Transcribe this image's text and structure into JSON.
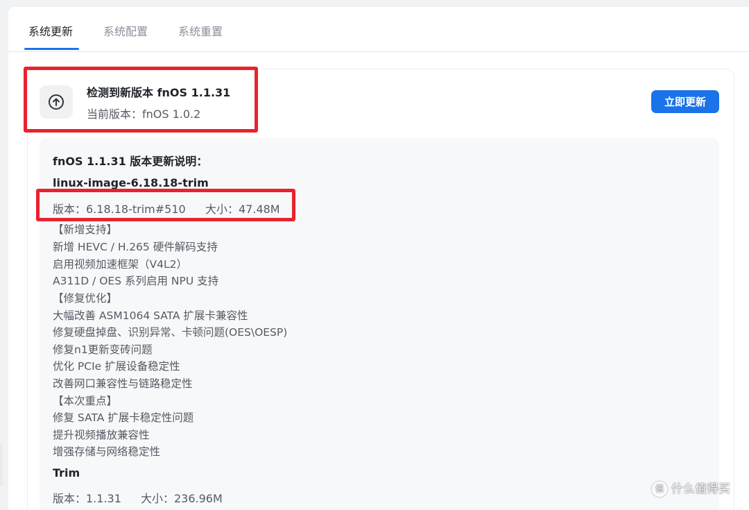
{
  "tabs": [
    {
      "label": "系统更新",
      "active": true
    },
    {
      "label": "系统配置",
      "active": false
    },
    {
      "label": "系统重置",
      "active": false
    }
  ],
  "update": {
    "icon": "arrow-up-circle-icon",
    "title": "检测到新版本 fnOS 1.1.31",
    "current_version": "当前版本：fnOS 1.0.2",
    "button_label": "立即更新"
  },
  "notes": {
    "heading": "fnOS 1.1.31 版本更新说明：",
    "packages": [
      {
        "name": "linux-image-6.18.18-trim",
        "version": "版本：6.18.18-trim#510",
        "size": "大小：47.48M",
        "lines": [
          "【新增支持】",
          "新增 HEVC / H.265 硬件解码支持",
          "启用视频加速框架（V4L2）",
          "A311D / OES 系列启用 NPU 支持",
          "【修复优化】",
          "大幅改善 ASM1064 SATA 扩展卡兼容性",
          "修复硬盘掉盘、识别异常、卡顿问题(OES\\OESP)",
          "修复n1更新变砖问题",
          "优化 PCIe 扩展设备稳定性",
          "改善网口兼容性与链路稳定性",
          "【本次重点】",
          "修复 SATA 扩展卡稳定性问题",
          "提升视频播放兼容性",
          "增强存储与网络稳定性"
        ]
      },
      {
        "name": "Trim",
        "version": "版本：1.1.31",
        "size": "大小：236.96M"
      }
    ]
  },
  "watermark": {
    "text": "什么值得买",
    "icon": "zhi-logo-icon"
  },
  "colors": {
    "accent": "#1a73e8",
    "highlight": "#e8232e"
  }
}
